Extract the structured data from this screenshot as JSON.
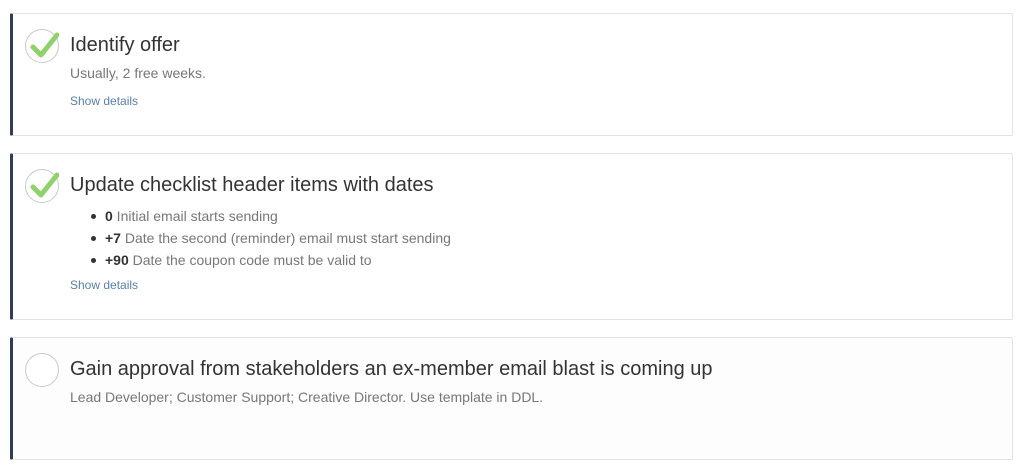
{
  "colors": {
    "accent_border": "#2f3e55",
    "check_green": "#8fd16a",
    "link": "#5b7fa8"
  },
  "tasks": [
    {
      "title": "Identify offer",
      "description": "Usually, 2 free weeks.",
      "completed": true,
      "show_details": "Show details"
    },
    {
      "title": "Update checklist header items with dates",
      "completed": true,
      "bullets": [
        {
          "key": "0",
          "text": " Initial email starts sending"
        },
        {
          "key": "+7",
          "text": " Date the second (reminder) email must start sending"
        },
        {
          "key": "+90",
          "text": " Date the coupon code must be valid to"
        }
      ],
      "show_details": "Show details"
    },
    {
      "title": "Gain approval from stakeholders an ex-member email blast is coming up",
      "description": "Lead Developer; Customer Support; Creative Director. Use template in DDL.",
      "completed": false
    }
  ]
}
